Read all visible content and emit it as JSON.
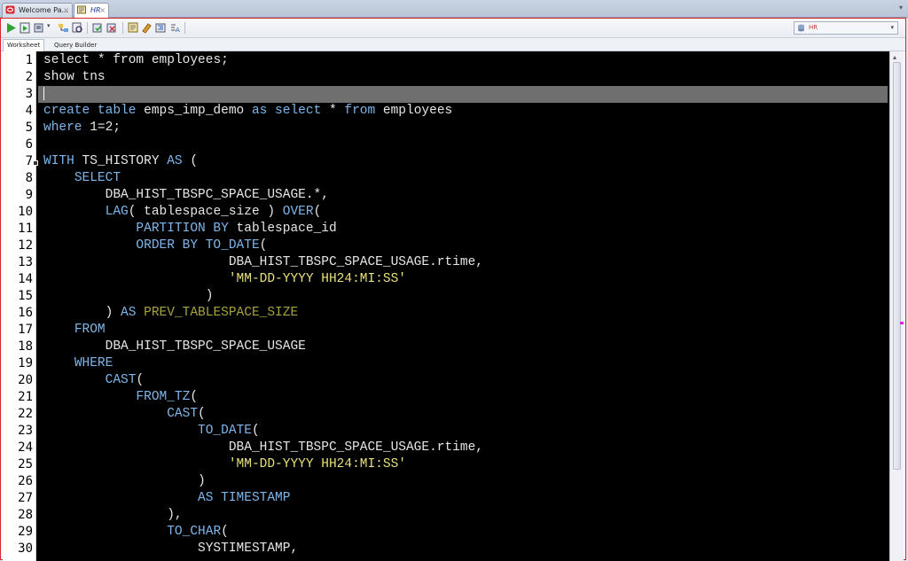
{
  "tabs": [
    {
      "label": "Welcome Pa...",
      "active": false
    },
    {
      "label": "HR",
      "active": true
    }
  ],
  "connection": {
    "selected": "HR"
  },
  "subtabs": [
    "Worksheet",
    "Query Builder"
  ],
  "toolbar_icons": [
    "run-statement-icon",
    "run-script-icon",
    "autotrace-icon",
    "explain-plan-icon",
    "sql-tuning-icon",
    "commit-icon",
    "rollback-icon",
    "unshared-sql-icon",
    "clear-icon",
    "format-icon",
    "history-icon"
  ],
  "colors": {
    "keyword": "#7eb6ea",
    "literal": "#e8e07a",
    "alias": "#a8a23c",
    "text": "#e6e6e6",
    "background": "#000000",
    "current_line": "#6f6f6f",
    "frame": "#d9262c"
  },
  "editor": {
    "current_line": 3,
    "lines": [
      [
        [
          "t",
          "select * "
        ],
        [
          "t",
          "from employees;"
        ]
      ],
      [
        [
          "t",
          "show tns"
        ]
      ],
      [],
      [
        [
          "k",
          "create table"
        ],
        [
          "t",
          " emps_imp_demo "
        ],
        [
          "k",
          "as select"
        ],
        [
          "t",
          " * "
        ],
        [
          "k",
          "from"
        ],
        [
          "t",
          " employees"
        ]
      ],
      [
        [
          "k",
          "where"
        ],
        [
          "t",
          " 1=2;"
        ]
      ],
      [],
      [
        [
          "k",
          "WITH"
        ],
        [
          "t",
          " TS_HISTORY "
        ],
        [
          "k",
          "AS"
        ],
        [
          "t",
          " ("
        ]
      ],
      [
        [
          "t",
          "    "
        ],
        [
          "k",
          "SELECT"
        ]
      ],
      [
        [
          "t",
          "        DBA_HIST_TBSPC_SPACE_USAGE.*,"
        ]
      ],
      [
        [
          "t",
          "        "
        ],
        [
          "k",
          "LAG"
        ],
        [
          "t",
          "( tablespace_size ) "
        ],
        [
          "k",
          "OVER"
        ],
        [
          "t",
          "("
        ]
      ],
      [
        [
          "t",
          "            "
        ],
        [
          "k",
          "PARTITION BY"
        ],
        [
          "t",
          " tablespace_id"
        ]
      ],
      [
        [
          "t",
          "            "
        ],
        [
          "k",
          "ORDER BY TO_DATE"
        ],
        [
          "t",
          "("
        ]
      ],
      [
        [
          "t",
          "                        DBA_HIST_TBSPC_SPACE_USAGE.rtime,"
        ]
      ],
      [
        [
          "t",
          "                        "
        ],
        [
          "l",
          "'MM-DD-YYYY HH24:MI:SS'"
        ]
      ],
      [
        [
          "t",
          "                     )"
        ]
      ],
      [
        [
          "t",
          "        ) "
        ],
        [
          "k",
          "AS"
        ],
        [
          "t",
          " "
        ],
        [
          "a",
          "PREV_TABLESPACE_SIZE"
        ]
      ],
      [
        [
          "t",
          "    "
        ],
        [
          "k",
          "FROM"
        ]
      ],
      [
        [
          "t",
          "        DBA_HIST_TBSPC_SPACE_USAGE"
        ]
      ],
      [
        [
          "t",
          "    "
        ],
        [
          "k",
          "WHERE"
        ]
      ],
      [
        [
          "t",
          "        "
        ],
        [
          "k",
          "CAST"
        ],
        [
          "t",
          "("
        ]
      ],
      [
        [
          "t",
          "            "
        ],
        [
          "k",
          "FROM_TZ"
        ],
        [
          "t",
          "("
        ]
      ],
      [
        [
          "t",
          "                "
        ],
        [
          "k",
          "CAST"
        ],
        [
          "t",
          "("
        ]
      ],
      [
        [
          "t",
          "                    "
        ],
        [
          "k",
          "TO_DATE"
        ],
        [
          "t",
          "("
        ]
      ],
      [
        [
          "t",
          "                        DBA_HIST_TBSPC_SPACE_USAGE.rtime,"
        ]
      ],
      [
        [
          "t",
          "                        "
        ],
        [
          "l",
          "'MM-DD-YYYY HH24:MI:SS'"
        ]
      ],
      [
        [
          "t",
          "                    )"
        ]
      ],
      [
        [
          "t",
          "                    "
        ],
        [
          "k",
          "AS TIMESTAMP"
        ]
      ],
      [
        [
          "t",
          "                ),"
        ]
      ],
      [
        [
          "t",
          "                "
        ],
        [
          "k",
          "TO_CHAR"
        ],
        [
          "t",
          "("
        ]
      ],
      [
        [
          "t",
          "                    SYSTIMESTAMP,"
        ]
      ]
    ]
  }
}
